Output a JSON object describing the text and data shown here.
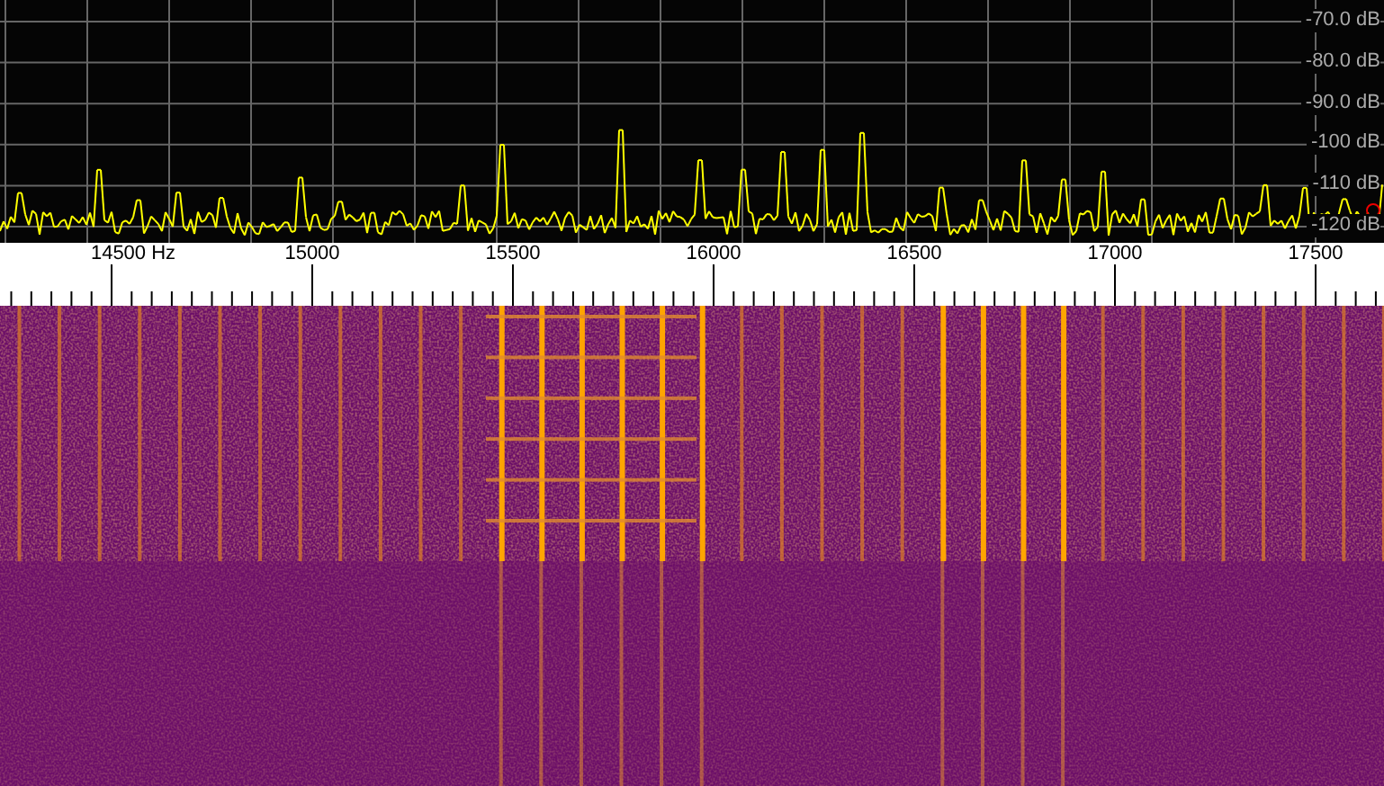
{
  "spectrum": {
    "db_labels": [
      "-70.0 dB",
      "-80.0 dB",
      "-90.0 dB",
      "-100 dB",
      "-110 dB",
      "-120 dB"
    ]
  },
  "frequency_axis": {
    "labels": [
      "14500 Hz",
      "15000",
      "15500",
      "16000",
      "16500",
      "17000",
      "17500"
    ]
  }
}
